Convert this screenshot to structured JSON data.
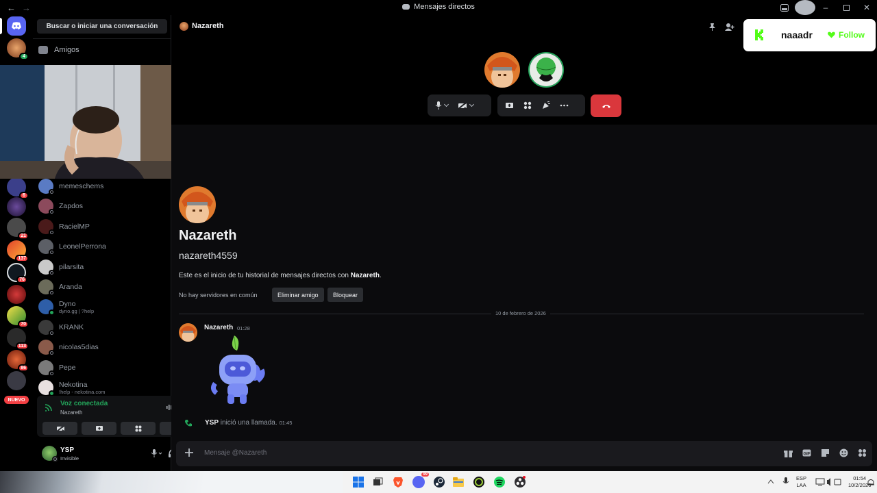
{
  "window": {
    "title": "Mensajes directos",
    "back_icon": "arrow-left-icon",
    "forward_icon": "arrow-right-icon"
  },
  "guild_rail": {
    "home_icon": "discord-logo-icon",
    "badges": [
      "4",
      "6",
      "21",
      "137",
      "76",
      "70",
      "113",
      "86"
    ],
    "new_label": "NUEVO"
  },
  "dm_sidebar": {
    "search_label": "Buscar o iniciar una conversación",
    "friends_label": "Amigos",
    "items": [
      {
        "name": "memeschems",
        "sub": "",
        "online": false,
        "color": "#5a7bc4"
      },
      {
        "name": "Zapdos",
        "sub": "",
        "online": false,
        "color": "#8c4a5c"
      },
      {
        "name": "RacielMP",
        "sub": "",
        "online": false,
        "color": "#4a1a1a"
      },
      {
        "name": "LeonelPerrona",
        "sub": "",
        "online": false,
        "color": "#5c5f66"
      },
      {
        "name": "pilarsita",
        "sub": "",
        "online": false,
        "color": "#c9c9c9"
      },
      {
        "name": "Aranda",
        "sub": "",
        "online": false,
        "color": "#6b6b5a"
      },
      {
        "name": "Dyno",
        "sub": "dyno.gg | ?help",
        "online": true,
        "color": "#2e5ea8"
      },
      {
        "name": "KRANK",
        "sub": "",
        "online": false,
        "color": "#3a3a3a"
      },
      {
        "name": "nicolas5dias",
        "sub": "",
        "online": false,
        "color": "#8a5a4a"
      },
      {
        "name": "Pepe",
        "sub": "",
        "online": false,
        "color": "#7a7a7a"
      },
      {
        "name": "Nekotina",
        "sub": "!help - nekotina.com",
        "online": true,
        "color": "#e8e0e0"
      }
    ]
  },
  "voice_panel": {
    "title": "Voz conectada",
    "channel": "Nazareth"
  },
  "user_panel": {
    "name": "YSP",
    "status": "Invisible"
  },
  "header": {
    "name": "Nazareth"
  },
  "kick_overlay": {
    "name": "naaadr",
    "follow_label": "Follow",
    "accent": "#53fc18"
  },
  "profile": {
    "display_name": "Nazareth",
    "username": "nazareth4559",
    "intro_prefix": "Este es el inicio de tu historial de mensajes directos con ",
    "intro_name": "Nazareth",
    "intro_suffix": ".",
    "mutual": "No hay servidores en común",
    "remove_friend": "Eliminar amigo",
    "block": "Bloquear"
  },
  "chat": {
    "date_divider": "10 de febrero de 2026",
    "message": {
      "author": "Nazareth",
      "time": "01:28"
    },
    "system": {
      "author": "YSP",
      "text": " inició una llamada.",
      "time": "01:45"
    }
  },
  "composer": {
    "placeholder": "Mensaje @Nazareth"
  },
  "taskbar": {
    "lang_top": "ESP",
    "lang_bottom": "LAA",
    "time": "01:54",
    "date": "10/2/2026",
    "discord_badge": "99"
  },
  "colors": {
    "accent": "#5865f2",
    "danger": "#da373c",
    "online": "#23a55a"
  }
}
